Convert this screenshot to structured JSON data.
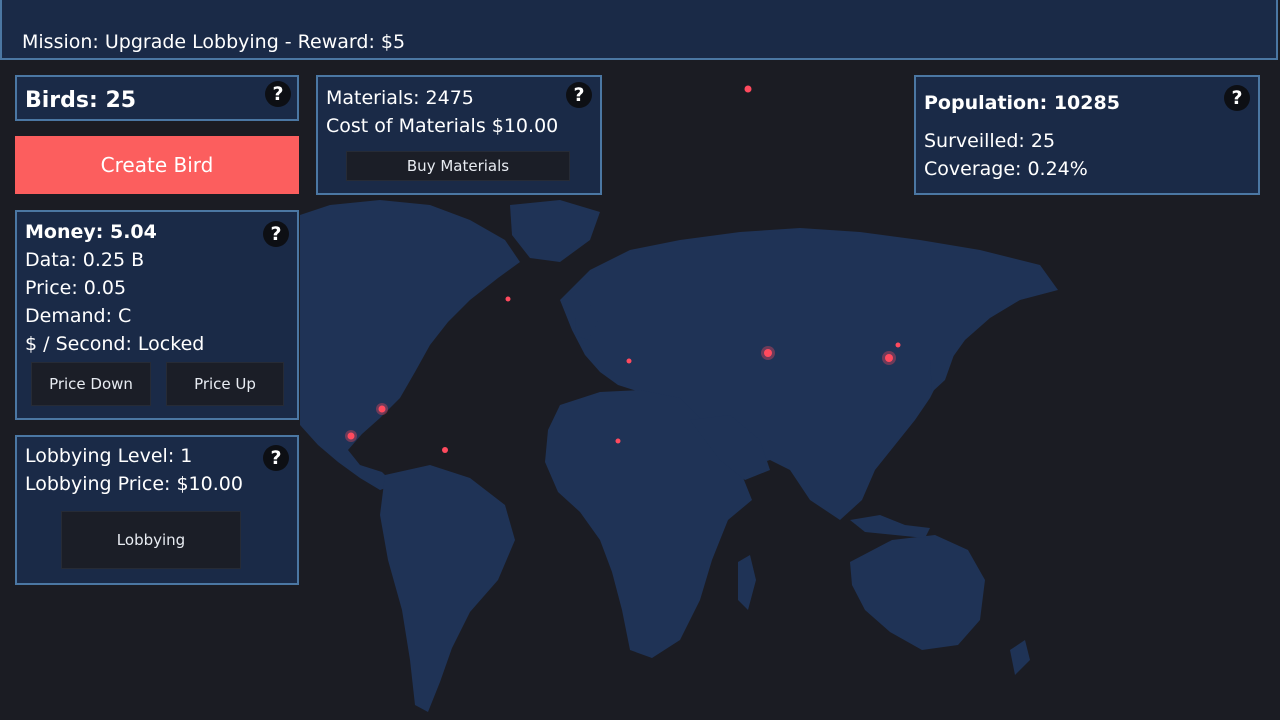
{
  "mission": {
    "text": "Mission: Upgrade Lobbying - Reward: $5"
  },
  "birds": {
    "label": "Birds: 25",
    "create_button": "Create Bird"
  },
  "materials": {
    "count": "Materials: 2475",
    "cost": "Cost of Materials $10.00",
    "buy_button": "Buy Materials"
  },
  "population": {
    "title": "Population: 10285",
    "surveilled": "Surveilled: 25",
    "coverage": "Coverage: 0.24%"
  },
  "money": {
    "title": "Money: 5.04",
    "data": "Data: 0.25 B",
    "price": "Price: 0.05",
    "demand": "Demand: C",
    "per_second": "$ / Second: Locked",
    "price_down_button": "Price Down",
    "price_up_button": "Price Up"
  },
  "lobbying": {
    "level": "Lobbying Level: 1",
    "price": "Lobbying Price: $10.00",
    "button": "Lobbying"
  },
  "help_symbol": "?",
  "colors": {
    "background": "#1b1c23",
    "panel": "#1a2a47",
    "panel_border": "#4b77a3",
    "land": "#1f3356",
    "create_button": "#fc5e5e",
    "marker": "#ff4a5e"
  }
}
